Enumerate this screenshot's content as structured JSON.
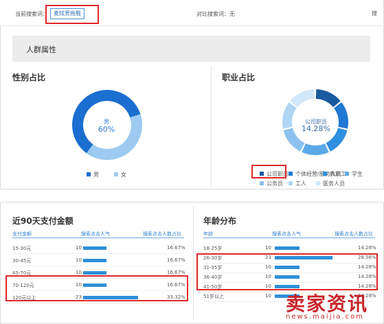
{
  "search_bar": {
    "current_label": "当前搜索词：",
    "keyword": "麦炫男拖鞋",
    "compare_label": "对比搜索词：无",
    "right_text": "搜"
  },
  "crowd": {
    "title": "人群属性"
  },
  "gender": {
    "title": "性别占比",
    "center_name": "男",
    "center_value": "60%",
    "legend": [
      {
        "label": "男",
        "color": "#1a6fd0"
      },
      {
        "label": "女",
        "color": "#9ccaf0"
      }
    ]
  },
  "job": {
    "title": "职业占比",
    "center_name": "公司职员",
    "center_value": "14.28%",
    "legend": [
      {
        "label": "公司职员",
        "color": "#1a5a9e"
      },
      {
        "label": "个体经营/服务人员",
        "color": "#1f78d1"
      },
      {
        "label": "教职工",
        "color": "#2f8fe0"
      },
      {
        "label": "学生",
        "color": "#5aa9e8"
      },
      {
        "label": "公务员",
        "color": "#8cc2ef"
      },
      {
        "label": "工人",
        "color": "#b0d6f5"
      },
      {
        "label": "医务人员",
        "color": "#d2e8fa"
      }
    ]
  },
  "chart_data": [
    {
      "type": "pie",
      "title": "性别占比",
      "categories": [
        "男",
        "女"
      ],
      "values": [
        60,
        40
      ],
      "colors": [
        "#1a6fd0",
        "#9ccaf0"
      ]
    },
    {
      "type": "pie",
      "title": "职业占比",
      "categories": [
        "公司职员",
        "个体经营/服务人员",
        "教职工",
        "学生",
        "公务员",
        "工人",
        "医务人员"
      ],
      "values": [
        14.28,
        14.29,
        14.29,
        14.28,
        14.29,
        14.29,
        14.28
      ],
      "colors": [
        "#1a5a9e",
        "#1f78d1",
        "#2f8fe0",
        "#5aa9e8",
        "#8cc2ef",
        "#b0d6f5",
        "#d2e8fa"
      ]
    },
    {
      "type": "table",
      "title": "近90天支付金额",
      "columns": [
        "支付金额",
        "搜索点击人气",
        "搜索点击人数占比"
      ],
      "rows": [
        {
          "label": "15-30元",
          "value": 10,
          "bar": 0.43,
          "pct": "16.67%"
        },
        {
          "label": "30-45元",
          "value": 10,
          "bar": 0.43,
          "pct": "16.67%"
        },
        {
          "label": "45-70元",
          "value": 10,
          "bar": 0.43,
          "pct": "16.67%"
        },
        {
          "label": "70-120元",
          "value": 10,
          "bar": 0.43,
          "pct": "16.67%"
        },
        {
          "label": "120元以上",
          "value": 23,
          "bar": 1.0,
          "pct": "33.32%"
        }
      ]
    },
    {
      "type": "table",
      "title": "年龄分布",
      "columns": [
        "年龄",
        "搜索点击人气",
        "搜索点击人数占比"
      ],
      "rows": [
        {
          "label": "18-25岁",
          "value": 10,
          "bar": 0.43,
          "pct": "14.28%"
        },
        {
          "label": "26-30岁",
          "value": 23,
          "bar": 1.0,
          "pct": "28.56%"
        },
        {
          "label": "31-35岁",
          "value": 10,
          "bar": 0.43,
          "pct": "14.28%"
        },
        {
          "label": "36-40岁",
          "value": 10,
          "bar": 0.43,
          "pct": "14.28%"
        },
        {
          "label": "41-50岁",
          "value": 10,
          "bar": 0.43,
          "pct": "14.28%"
        },
        {
          "label": "51岁以上",
          "value": 10,
          "bar": 0.43,
          "pct": "14.28%"
        }
      ]
    }
  ],
  "watermark": {
    "logo_text": "卖家资讯",
    "url": "news.maijia.com"
  }
}
